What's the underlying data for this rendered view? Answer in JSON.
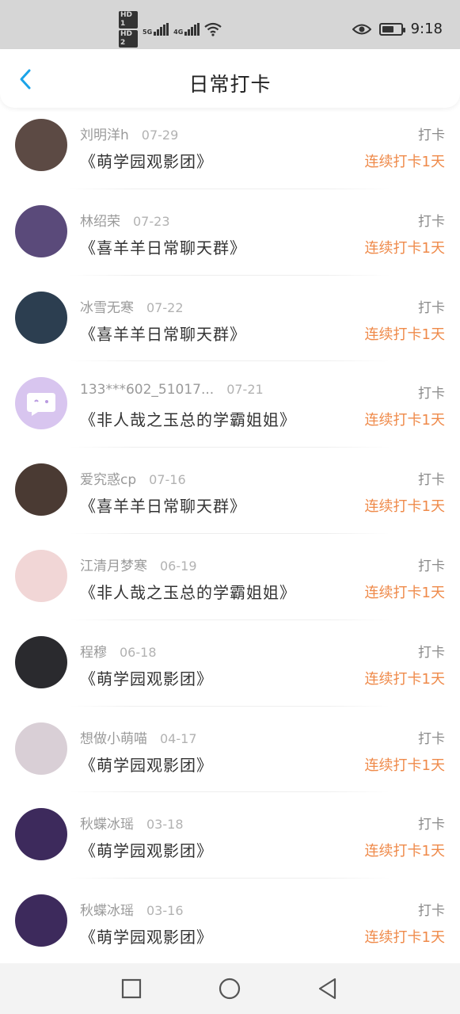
{
  "status_bar": {
    "hd1": "HD 1",
    "hd2": "HD 2",
    "net1": "5G",
    "net2": "4G",
    "time": "9:18",
    "battery_level": 0.65
  },
  "header": {
    "title": "日常打卡",
    "accent_color": "#1aa3e8"
  },
  "items": [
    {
      "user": "刘明洋h",
      "date": "07-29",
      "group": "《萌学园观影团》",
      "punch": "打卡",
      "streak": "连续打卡1天",
      "avatar_color": "#5c4a44"
    },
    {
      "user": "林绍荣",
      "date": "07-23",
      "group": "《喜羊羊日常聊天群》",
      "punch": "打卡",
      "streak": "连续打卡1天",
      "avatar_color": "#5a4a7a"
    },
    {
      "user": "冰雪无寒",
      "date": "07-22",
      "group": "《喜羊羊日常聊天群》",
      "punch": "打卡",
      "streak": "连续打卡1天",
      "avatar_color": "#2c3e50"
    },
    {
      "user": "133***602_51017...",
      "date": "07-21",
      "group": "《非人哉之玉总的学霸姐姐》",
      "punch": "打卡",
      "streak": "连续打卡1天",
      "avatar_color": "#d8c5ef"
    },
    {
      "user": "爱究惑cp",
      "date": "07-16",
      "group": "《喜羊羊日常聊天群》",
      "punch": "打卡",
      "streak": "连续打卡1天",
      "avatar_color": "#4a3a33"
    },
    {
      "user": "江清月梦寒",
      "date": "06-19",
      "group": "《非人哉之玉总的学霸姐姐》",
      "punch": "打卡",
      "streak": "连续打卡1天",
      "avatar_color": "#f1d6d6"
    },
    {
      "user": "程穆",
      "date": "06-18",
      "group": "《萌学园观影团》",
      "punch": "打卡",
      "streak": "连续打卡1天",
      "avatar_color": "#2a2a2e"
    },
    {
      "user": "想做小萌喵",
      "date": "04-17",
      "group": "《萌学园观影团》",
      "punch": "打卡",
      "streak": "连续打卡1天",
      "avatar_color": "#d9cfd6"
    },
    {
      "user": "秋蝶冰瑶",
      "date": "03-18",
      "group": "《萌学园观影团》",
      "punch": "打卡",
      "streak": "连续打卡1天",
      "avatar_color": "#3d2a5c"
    },
    {
      "user": "秋蝶冰瑶",
      "date": "03-16",
      "group": "《萌学园观影团》",
      "punch": "打卡",
      "streak": "连续打卡1天",
      "avatar_color": "#3d2a5c"
    }
  ],
  "icons": {
    "back": "chevron-left-icon",
    "eye": "eye-icon",
    "wifi": "wifi-icon",
    "battery": "battery-icon",
    "nav_recent": "square-icon",
    "nav_home": "circle-icon",
    "nav_back": "triangle-back-icon"
  }
}
